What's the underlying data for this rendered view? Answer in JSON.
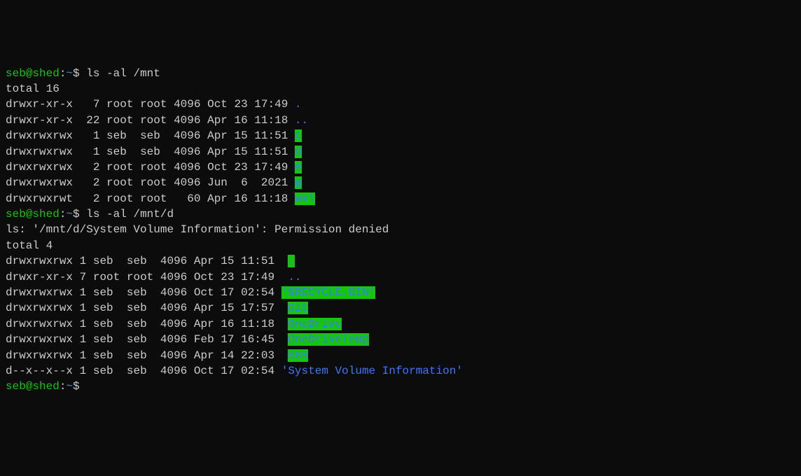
{
  "prompt": {
    "user": "seb",
    "at": "@",
    "host": "shed",
    "sep": ":",
    "path": "~",
    "dollar": "$ "
  },
  "cmd1": "ls -al /mnt",
  "total1": "total 16",
  "mnt": {
    "r0": {
      "perm": "drwxr-xr-x",
      "n": "  7",
      "own": "root",
      "grp": "root",
      "sz": "4096",
      "dt": "Oct 23 17:49",
      "name": "."
    },
    "r1": {
      "perm": "drwxr-xr-x",
      "n": " 22",
      "own": "root",
      "grp": "root",
      "sz": "4096",
      "dt": "Apr 16 11:18",
      "name": ".."
    },
    "r2": {
      "perm": "drwxrwxrwx",
      "n": "  1",
      "own": "seb ",
      "grp": "seb ",
      "sz": "4096",
      "dt": "Apr 15 11:51",
      "name": "c"
    },
    "r3": {
      "perm": "drwxrwxrwx",
      "n": "  1",
      "own": "seb ",
      "grp": "seb ",
      "sz": "4096",
      "dt": "Apr 15 11:51",
      "name": "d"
    },
    "r4": {
      "perm": "drwxrwxrwx",
      "n": "  2",
      "own": "root",
      "grp": "root",
      "sz": "4096",
      "dt": "Oct 23 17:49",
      "name": "e"
    },
    "r5": {
      "perm": "drwxrwxrwx",
      "n": "  2",
      "own": "root",
      "grp": "root",
      "sz": "4096",
      "dt": "Jun  6  2021",
      "name": "g"
    },
    "r6": {
      "perm": "drwxrwxrwt",
      "n": "  2",
      "own": "root",
      "grp": "root",
      "sz": "  60",
      "dt": "Apr 16 11:18",
      "name": "wsl"
    }
  },
  "cmd2": "ls -al /mnt/d",
  "err": "ls: '/mnt/d/System Volume Information': Permission denied",
  "total2": "total 4",
  "d": {
    "r0": {
      "perm": "drwxrwxrwx",
      "n": "1",
      "own": "seb ",
      "grp": "seb ",
      "sz": "4096",
      "dt": "Apr 15 11:51",
      "name": "."
    },
    "r1": {
      "perm": "drwxr-xr-x",
      "n": "7",
      "own": "root",
      "grp": "root",
      "sz": "4096",
      "dt": "Oct 23 17:49",
      "name": ".."
    },
    "r2": {
      "perm": "drwxrwxrwx",
      "n": "1",
      "own": "seb ",
      "grp": "seb ",
      "sz": "4096",
      "dt": "Oct 17 02:54",
      "name": "'$RECYCLE.BIN'"
    },
    "r3": {
      "perm": "drwxrwxrwx",
      "n": "1",
      "own": "seb ",
      "grp": "seb ",
      "sz": "4096",
      "dt": "Apr 15 17:57",
      "name": "Git"
    },
    "r4": {
      "perm": "drwxrwxrwx",
      "n": "1",
      "own": "seb ",
      "grp": "seb ",
      "sz": "4096",
      "dt": "Apr 16 11:18",
      "name": "OneDrive"
    },
    "r5": {
      "perm": "drwxrwxrwx",
      "n": "1",
      "own": "seb ",
      "grp": "seb ",
      "sz": "4096",
      "dt": "Feb 17 16:45",
      "name": "OneDriveTemp"
    },
    "r6": {
      "perm": "drwxrwxrwx",
      "n": "1",
      "own": "seb ",
      "grp": "seb ",
      "sz": "4096",
      "dt": "Apr 14 22:03",
      "name": "SGS"
    },
    "r7": {
      "perm": "d--x--x--x",
      "n": "1",
      "own": "seb ",
      "grp": "seb ",
      "sz": "4096",
      "dt": "Oct 17 02:54",
      "name": "'System Volume Information'"
    }
  }
}
